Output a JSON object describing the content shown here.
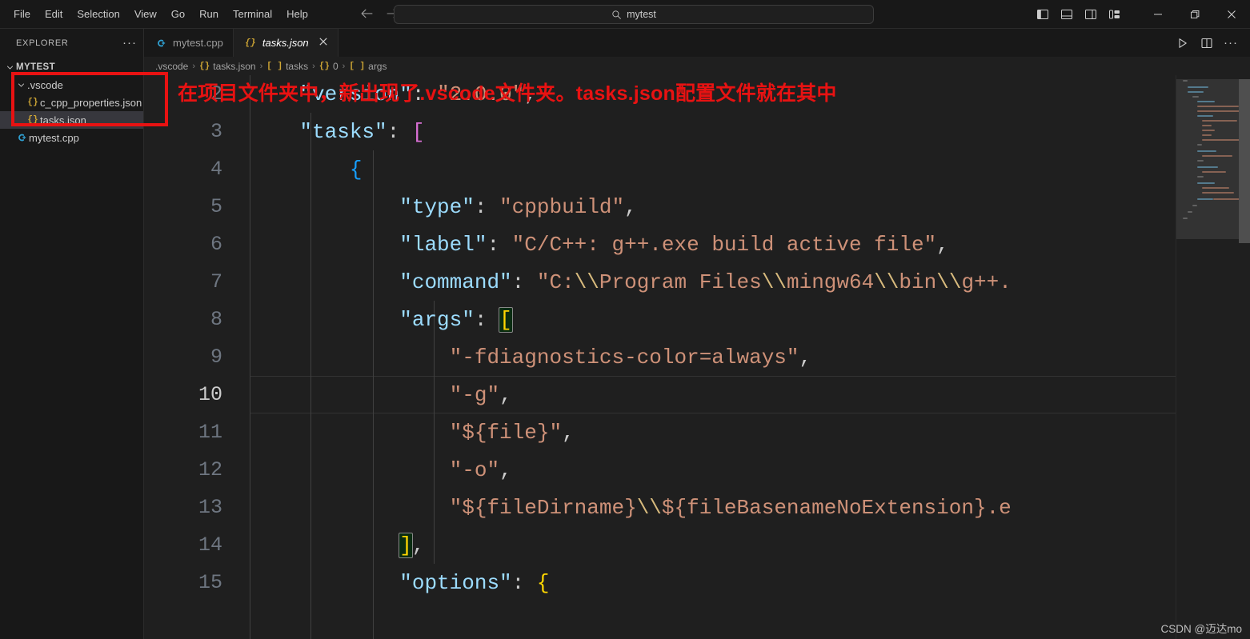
{
  "window": {
    "menu_items": [
      "File",
      "Edit",
      "Selection",
      "View",
      "Go",
      "Run",
      "Terminal",
      "Help"
    ],
    "nav_back": "←",
    "nav_forward": "→",
    "search_value": "mytest",
    "search_icon": "⌕",
    "layout_icons": [
      "toggle-primary-sidebar",
      "toggle-panel",
      "toggle-secondary-sidebar",
      "customize-layout"
    ],
    "minimize": "—",
    "restore": "❐",
    "close": "✕"
  },
  "sidebar": {
    "title": "EXPLORER",
    "more_actions": "···",
    "root": "MYTEST",
    "items": [
      {
        "label": ".vscode",
        "icon": "folder-open-icon",
        "indent": 1,
        "type": "folder",
        "selected": false
      },
      {
        "label": "c_cpp_properties.json",
        "icon": "json-icon",
        "indent": 2,
        "type": "file",
        "selected": false
      },
      {
        "label": "tasks.json",
        "icon": "json-icon",
        "indent": 2,
        "type": "file",
        "selected": true
      },
      {
        "label": "mytest.cpp",
        "icon": "cpp-icon",
        "indent": 1,
        "type": "file",
        "selected": false
      }
    ]
  },
  "tabs": [
    {
      "label": "mytest.cpp",
      "icon": "cpp-icon",
      "active": false,
      "closable": false
    },
    {
      "label": "tasks.json",
      "icon": "json-icon",
      "active": true,
      "closable": true
    }
  ],
  "tab_actions": {
    "run": "run-icon",
    "split": "split-editor-icon",
    "more": "···"
  },
  "breadcrumb": [
    {
      "icon": "",
      "label": ".vscode"
    },
    {
      "icon": "{}",
      "label": "tasks.json"
    },
    {
      "icon": "[ ]",
      "label": "tasks"
    },
    {
      "icon": "{}",
      "label": "0"
    },
    {
      "icon": "[ ]",
      "label": "args"
    }
  ],
  "breadcrumb_separator": "›",
  "code": {
    "current_line": 10,
    "lines": [
      {
        "n": 2,
        "indent": 0,
        "html": "pad1"
      },
      {
        "n": 3,
        "indent": 0,
        "html": "pad2"
      },
      {
        "n": 4,
        "indent": 0,
        "html": "pad3"
      },
      {
        "n": 5,
        "indent": 0,
        "html": "pad4"
      },
      {
        "n": 6,
        "indent": 0,
        "html": "pad5"
      },
      {
        "n": 7,
        "indent": 0,
        "html": "pad6"
      },
      {
        "n": 8,
        "indent": 0,
        "html": "pad7"
      },
      {
        "n": 9,
        "indent": 0,
        "html": "pad8"
      },
      {
        "n": 10,
        "indent": 0,
        "html": "pad9"
      },
      {
        "n": 11,
        "indent": 0,
        "html": "pad10"
      },
      {
        "n": 12,
        "indent": 0,
        "html": "pad11"
      },
      {
        "n": 13,
        "indent": 0,
        "html": "pad12"
      },
      {
        "n": 14,
        "indent": 0,
        "html": "pad13"
      },
      {
        "n": 15,
        "indent": 0,
        "html": "pad14"
      }
    ],
    "text": {
      "l2": "    \"version\": \"2.0.0\",",
      "l3": "    \"tasks\": [",
      "l4": "        {",
      "l5": "            \"type\": \"cppbuild\",",
      "l6": "            \"label\": \"C/C++: g++.exe build active file\",",
      "l7": "            \"command\": \"C:\\\\Program Files\\\\mingw64\\\\bin\\\\g++.",
      "l8": "            \"args\": [",
      "l9": "                \"-fdiagnostics-color=always\",",
      "l10": "                \"-g\",",
      "l11": "                \"${file}\",",
      "l12": "                \"-o\",",
      "l13": "                \"${fileDirname}\\\\${fileBasenameNoExtension}.e",
      "l14": "            ],",
      "l15": "            \"options\": {"
    }
  },
  "annotation": {
    "text": "在项目文件夹中，新出现了.vscode文件夹。tasks.json配置文件就在其中",
    "color": "#e81212"
  },
  "watermark": {
    "text": "CSDN @迈达mo"
  },
  "colors": {
    "bg_editor": "#1f1f1f",
    "bg_sidebar": "#181818",
    "bg_titlebar": "#181818",
    "selection": "#37373d",
    "key": "#9cdcfe",
    "string": "#ce9178",
    "escape": "#d7ba7d",
    "bracket1": "#ffd700",
    "bracket2": "#da70d6",
    "bracket3": "#179fff",
    "linenum": "#6e7681",
    "accent_red": "#e81212"
  }
}
